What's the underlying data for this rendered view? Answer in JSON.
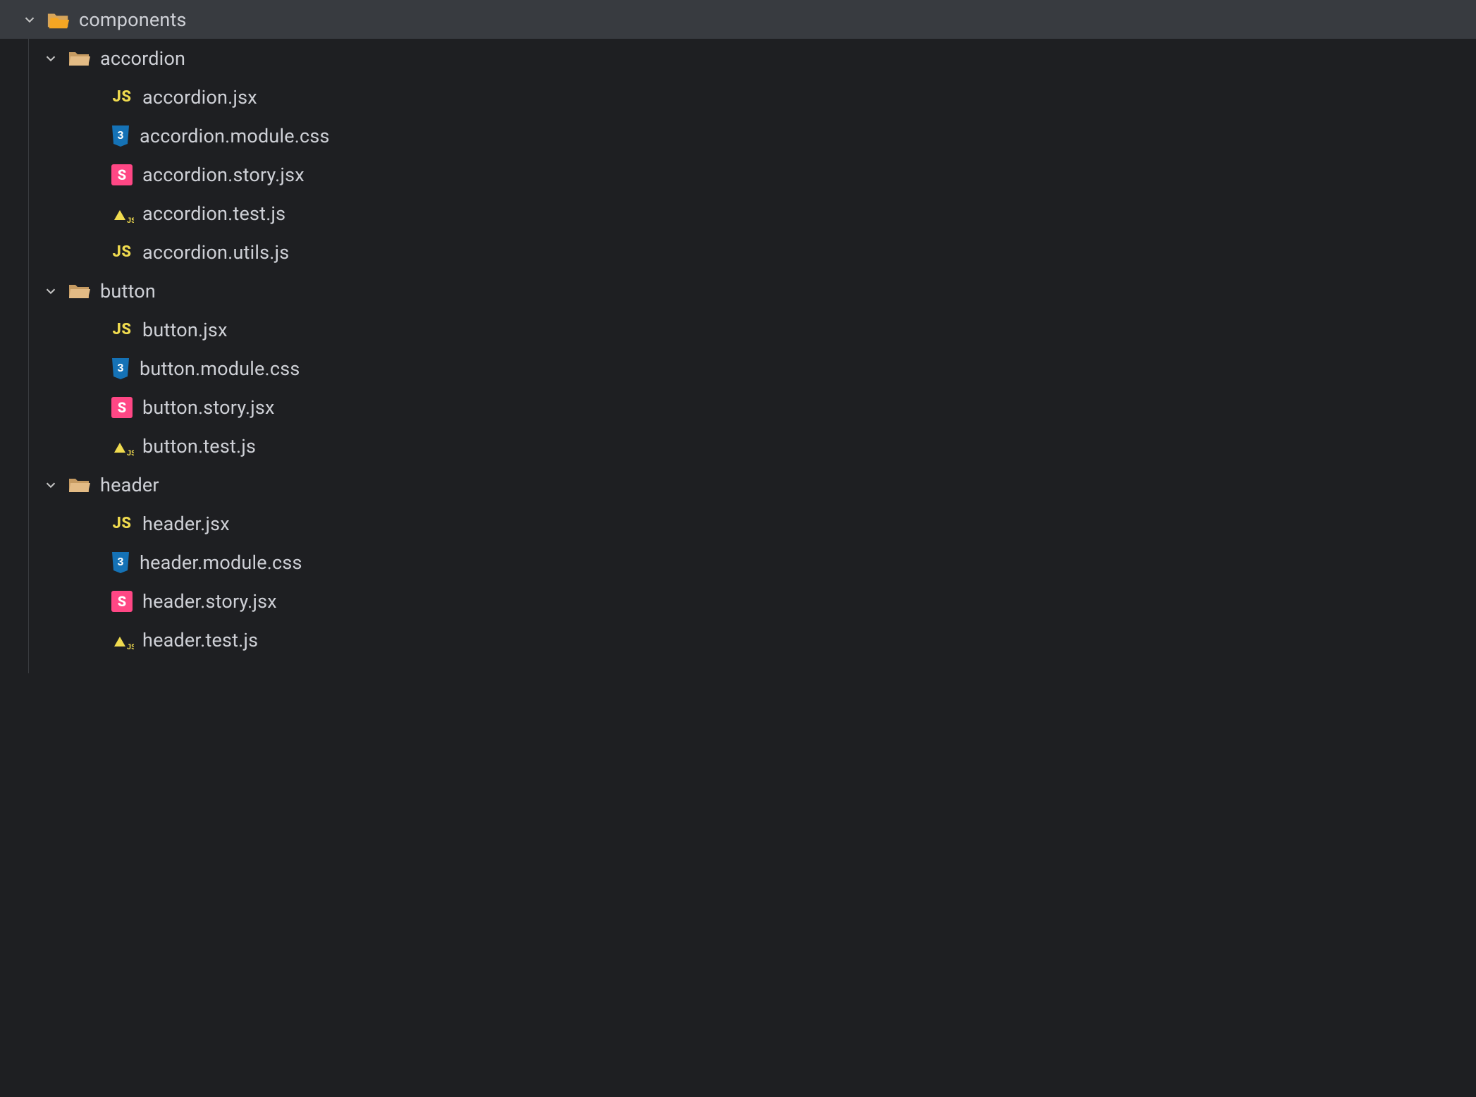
{
  "tree": {
    "root": {
      "name": "components",
      "expanded": true,
      "icon": "folder-root",
      "children": [
        {
          "name": "accordion",
          "expanded": true,
          "icon": "folder-open",
          "children": [
            {
              "name": "accordion.jsx",
              "icon": "js"
            },
            {
              "name": "accordion.module.css",
              "icon": "css"
            },
            {
              "name": "accordion.story.jsx",
              "icon": "storybook"
            },
            {
              "name": "accordion.test.js",
              "icon": "test"
            },
            {
              "name": "accordion.utils.js",
              "icon": "js"
            }
          ]
        },
        {
          "name": "button",
          "expanded": true,
          "icon": "folder-open",
          "children": [
            {
              "name": "button.jsx",
              "icon": "js"
            },
            {
              "name": "button.module.css",
              "icon": "css"
            },
            {
              "name": "button.story.jsx",
              "icon": "storybook"
            },
            {
              "name": "button.test.js",
              "icon": "test"
            }
          ]
        },
        {
          "name": "header",
          "expanded": true,
          "icon": "folder-open",
          "children": [
            {
              "name": "header.jsx",
              "icon": "js"
            },
            {
              "name": "header.module.css",
              "icon": "css"
            },
            {
              "name": "header.story.jsx",
              "icon": "storybook"
            },
            {
              "name": "header.test.js",
              "icon": "test"
            }
          ]
        }
      ]
    }
  }
}
